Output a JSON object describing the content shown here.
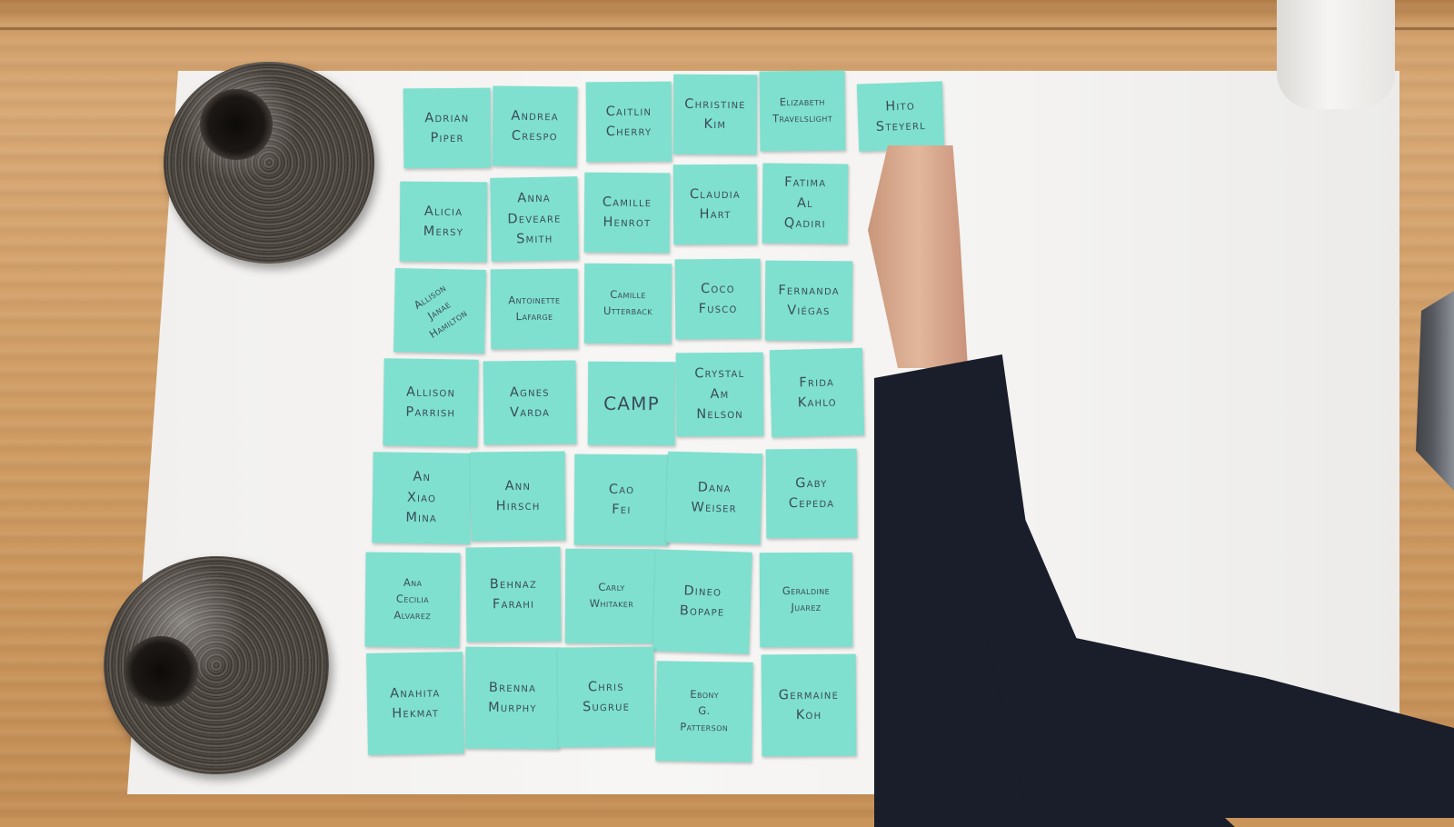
{
  "scene": {
    "description_colors": {
      "note": "#7fe0cf",
      "ink": "#3a4c5a",
      "paper": "#f4f3f1",
      "table": "#d2a06a",
      "sleeve": "#1a1d2a"
    }
  },
  "notes": [
    {
      "id": "adrian-piper",
      "text": "Adrian\nPiper"
    },
    {
      "id": "andrea-crespo",
      "text": "Andrea\nCrespo"
    },
    {
      "id": "caitlin-cherry",
      "text": "Caitlin\nCherry"
    },
    {
      "id": "christine-kim",
      "text": "Christine\nKim"
    },
    {
      "id": "elizabeth-travelslight",
      "text": "Elizabeth\nTravelslight"
    },
    {
      "id": "hito-steyerl",
      "text": "Hito\nSteyerl"
    },
    {
      "id": "alicia-mersy",
      "text": "Alicia\nMersy"
    },
    {
      "id": "anna-deveare-smith",
      "text": "Anna\nDeveare\nSmith"
    },
    {
      "id": "camille-henrot",
      "text": "Camille\nHenrot"
    },
    {
      "id": "claudia-hart",
      "text": "Claudia\nHart"
    },
    {
      "id": "fatima-al-qadiri",
      "text": "Fatima\nAl\nQadiri"
    },
    {
      "id": "allison-janae-hamilton",
      "text": "Allison\nJanae\nHamilton"
    },
    {
      "id": "antoinette-lafarge",
      "text": "Antoinette\nLafarge"
    },
    {
      "id": "camille-utterback",
      "text": "Camille\nUtterback"
    },
    {
      "id": "coco-fusco",
      "text": "Coco\nFusco"
    },
    {
      "id": "fernanda-viegas",
      "text": "Fernanda\nViégas"
    },
    {
      "id": "allison-parrish",
      "text": "Allison\nParrish"
    },
    {
      "id": "agnes-varda",
      "text": "Agnes\nVarda"
    },
    {
      "id": "camp",
      "text": "CAMP"
    },
    {
      "id": "crystal-am-nelson",
      "text": "Crystal\nAm\nNelson"
    },
    {
      "id": "frida-kahlo",
      "text": "Frida\nKahlo"
    },
    {
      "id": "an-xiao-mina",
      "text": "An\nXiao\nMina"
    },
    {
      "id": "ann-hirsch",
      "text": "Ann\nHirsch"
    },
    {
      "id": "cao-fei",
      "text": "Cao\nFei"
    },
    {
      "id": "dana-weiser",
      "text": "Dana\nWeiser"
    },
    {
      "id": "gaby-cepeda",
      "text": "Gaby\nCepeda"
    },
    {
      "id": "ana-cecilia-alvarez",
      "text": "Ana\nCecilia\nAlvarez"
    },
    {
      "id": "behnaz-farahi",
      "text": "Behnaz\nFarahi"
    },
    {
      "id": "carly-whitaker",
      "text": "Carly\nWhitaker"
    },
    {
      "id": "dineo-bopape",
      "text": "Dineo\nBopape"
    },
    {
      "id": "geraldine-juarez",
      "text": "Geraldine\nJuarez"
    },
    {
      "id": "anahita-hekmat",
      "text": "Anahita\nHekmat"
    },
    {
      "id": "brenna-murphy",
      "text": "Brenna\nMurphy"
    },
    {
      "id": "chris-sugrue",
      "text": "Chris\nSugrue"
    },
    {
      "id": "ebony-g-patterson",
      "text": "Ebony\nG.\nPatterson"
    },
    {
      "id": "germaine-koh",
      "text": "Germaine\nKoh"
    }
  ]
}
